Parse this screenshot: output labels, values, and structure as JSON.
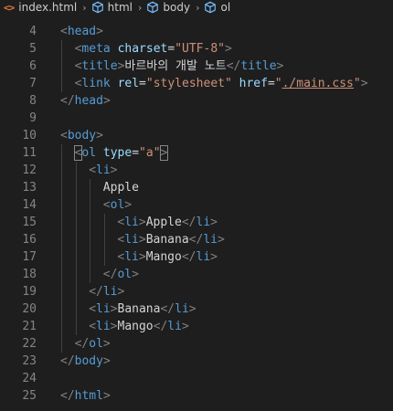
{
  "breadcrumb": {
    "file": "index.html",
    "html_icon": "<>",
    "items": [
      "html",
      "body",
      "ol"
    ],
    "chevron": "›"
  },
  "lines": [
    {
      "num": "4",
      "parts": [
        [
          "punct",
          "<"
        ],
        [
          "tag",
          "head"
        ],
        [
          "punct",
          ">"
        ]
      ],
      "indent": 0
    },
    {
      "num": "5",
      "parts": [
        [
          "punct",
          "<"
        ],
        [
          "tag",
          "meta "
        ],
        [
          "attr",
          "charset"
        ],
        [
          "txt",
          "="
        ],
        [
          "str",
          "\"UTF-8\""
        ],
        [
          "punct",
          ">"
        ]
      ],
      "indent": 1
    },
    {
      "num": "6",
      "parts": [
        [
          "punct",
          "<"
        ],
        [
          "tag",
          "title"
        ],
        [
          "punct",
          ">"
        ],
        [
          "txt",
          "바르바의 개발 노트"
        ],
        [
          "punct",
          "</"
        ],
        [
          "tag",
          "title"
        ],
        [
          "punct",
          ">"
        ]
      ],
      "indent": 1
    },
    {
      "num": "7",
      "parts": [
        [
          "punct",
          "<"
        ],
        [
          "tag",
          "link "
        ],
        [
          "attr",
          "rel"
        ],
        [
          "txt",
          "="
        ],
        [
          "str",
          "\"stylesheet\" "
        ],
        [
          "attr",
          "href"
        ],
        [
          "txt",
          "="
        ],
        [
          "str",
          "\""
        ],
        [
          "strlink",
          "./main.css"
        ],
        [
          "str",
          "\""
        ],
        [
          "punct",
          ">"
        ]
      ],
      "indent": 1
    },
    {
      "num": "8",
      "parts": [
        [
          "punct",
          "</"
        ],
        [
          "tag",
          "head"
        ],
        [
          "punct",
          ">"
        ]
      ],
      "indent": 0
    },
    {
      "num": "9",
      "parts": [],
      "indent": 0
    },
    {
      "num": "10",
      "parts": [
        [
          "punct",
          "<"
        ],
        [
          "tag",
          "body"
        ],
        [
          "punct",
          ">"
        ]
      ],
      "indent": 0
    },
    {
      "num": "11",
      "parts": [
        [
          "hlpunct",
          "<"
        ],
        [
          "tag",
          "ol "
        ],
        [
          "attr",
          "type"
        ],
        [
          "txt",
          "="
        ],
        [
          "str",
          "\"a\""
        ],
        [
          "hlpunct",
          ">"
        ]
      ],
      "indent": 1
    },
    {
      "num": "12",
      "parts": [
        [
          "punct",
          "<"
        ],
        [
          "tag",
          "li"
        ],
        [
          "punct",
          ">"
        ]
      ],
      "indent": 2
    },
    {
      "num": "13",
      "parts": [
        [
          "txt",
          "Apple"
        ]
      ],
      "indent": 3
    },
    {
      "num": "14",
      "parts": [
        [
          "punct",
          "<"
        ],
        [
          "tag",
          "ol"
        ],
        [
          "punct",
          ">"
        ]
      ],
      "indent": 3
    },
    {
      "num": "15",
      "parts": [
        [
          "punct",
          "<"
        ],
        [
          "tag",
          "li"
        ],
        [
          "punct",
          ">"
        ],
        [
          "txt",
          "Apple"
        ],
        [
          "punct",
          "</"
        ],
        [
          "tag",
          "li"
        ],
        [
          "punct",
          ">"
        ]
      ],
      "indent": 4
    },
    {
      "num": "16",
      "parts": [
        [
          "punct",
          "<"
        ],
        [
          "tag",
          "li"
        ],
        [
          "punct",
          ">"
        ],
        [
          "txt",
          "Banana"
        ],
        [
          "punct",
          "</"
        ],
        [
          "tag",
          "li"
        ],
        [
          "punct",
          ">"
        ]
      ],
      "indent": 4
    },
    {
      "num": "17",
      "parts": [
        [
          "punct",
          "<"
        ],
        [
          "tag",
          "li"
        ],
        [
          "punct",
          ">"
        ],
        [
          "txt",
          "Mango"
        ],
        [
          "punct",
          "</"
        ],
        [
          "tag",
          "li"
        ],
        [
          "punct",
          ">"
        ]
      ],
      "indent": 4
    },
    {
      "num": "18",
      "parts": [
        [
          "punct",
          "</"
        ],
        [
          "tag",
          "ol"
        ],
        [
          "punct",
          ">"
        ]
      ],
      "indent": 3
    },
    {
      "num": "19",
      "parts": [
        [
          "punct",
          "</"
        ],
        [
          "tag",
          "li"
        ],
        [
          "punct",
          ">"
        ]
      ],
      "indent": 2
    },
    {
      "num": "20",
      "parts": [
        [
          "punct",
          "<"
        ],
        [
          "tag",
          "li"
        ],
        [
          "punct",
          ">"
        ],
        [
          "txt",
          "Banana"
        ],
        [
          "punct",
          "</"
        ],
        [
          "tag",
          "li"
        ],
        [
          "punct",
          ">"
        ]
      ],
      "indent": 2
    },
    {
      "num": "21",
      "parts": [
        [
          "punct",
          "<"
        ],
        [
          "tag",
          "li"
        ],
        [
          "punct",
          ">"
        ],
        [
          "txt",
          "Mango"
        ],
        [
          "punct",
          "</"
        ],
        [
          "tag",
          "li"
        ],
        [
          "punct",
          ">"
        ]
      ],
      "indent": 2
    },
    {
      "num": "22",
      "parts": [
        [
          "punct",
          "</"
        ],
        [
          "tag",
          "ol"
        ],
        [
          "punct",
          ">"
        ]
      ],
      "indent": 1
    },
    {
      "num": "23",
      "parts": [
        [
          "punct",
          "</"
        ],
        [
          "tag",
          "body"
        ],
        [
          "punct",
          ">"
        ]
      ],
      "indent": 0
    },
    {
      "num": "24",
      "parts": [],
      "indent": 0
    },
    {
      "num": "25",
      "parts": [
        [
          "punct",
          "</"
        ],
        [
          "tag",
          "html"
        ],
        [
          "punct",
          ">"
        ]
      ],
      "indent": 0
    }
  ],
  "colors": {
    "background": "#1e1e1e",
    "tag": "#569cd6",
    "attribute": "#9cdcfe",
    "string": "#ce9178",
    "text": "#d4d4d4",
    "line_number": "#858585",
    "html_file_icon": "#e37933",
    "symbol_icon": "#75beff"
  },
  "icons": {
    "file": "html-file-icon",
    "symbol": "symbol-element-icon",
    "separator": "chevron-right-icon"
  }
}
